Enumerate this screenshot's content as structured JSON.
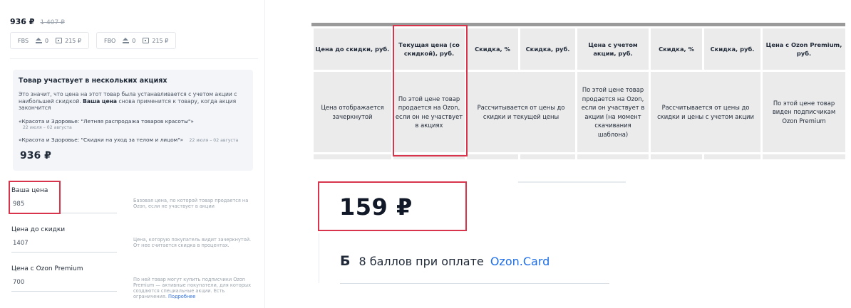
{
  "left": {
    "price": "936 ₽",
    "old_price": "1 407 ₽",
    "stock": [
      {
        "label": "FBS",
        "qty": "0",
        "price": "215 ₽"
      },
      {
        "label": "FBO",
        "qty": "0",
        "price": "215 ₽"
      }
    ],
    "promo": {
      "title": "Товар участвует в нескольких акциях",
      "text_a": "Это значит, что цена на этот товар была устанавливается с учетом акции с наибольшей скидкой.",
      "text_bold": "Ваша цена",
      "text_b": "снова применится к товару, когда акция закончится",
      "items": [
        {
          "name": "«Красота и Здоровье: \"Летняя распродажа товаров красоты\"»",
          "date": "22 июля – 02 августа"
        },
        {
          "name": "«Красота и Здоровье: \"Скидки на уход за телом и лицом\"»",
          "date": "22 июля – 02 августа"
        }
      ],
      "price": "936 ₽"
    },
    "fields": [
      {
        "label": "Ваша цена",
        "value": "985",
        "hint": "Базовая цена, по которой товар продается на Ozon, если не участвует в акции"
      },
      {
        "label": "Цена до скидки",
        "value": "1407",
        "hint": "Цена, которую покупатель видит зачеркнутой. От нее считается скидка в процентах."
      },
      {
        "label": "Цена с Ozon Premium",
        "value": "700",
        "hint": "По ней товар могут купить подписчики Ozon Premium — активные покупатели, для которых создаются специальные акции. Есть ограничения.",
        "hint_link": "Подробнее"
      }
    ]
  },
  "table": {
    "headers": [
      "Цена до скидки, руб.",
      "Текущая цена (со скидкой), руб.",
      "Скидка, %",
      "Скидка, руб.",
      "Цена с учетом акции, руб.",
      "Скидка, %",
      "Скидка, руб.",
      "Цена с Ozon Premium, руб."
    ],
    "body": {
      "col1": "Цена отображается зачеркнутой",
      "col2": "По этой цене товар продается на Ozon, если он не участвует в акциях",
      "col34": "Рассчитывается от цены до скидки и текущей цены",
      "col5": "По этой цене товар продается на Ozon, если он участвует в акции (на момент скачивания шаблона)",
      "col67": "Рассчитывается от цены до скидки и цены с учетом акции",
      "col8": "По этой цене товар виден подписчикам Ozon Premium"
    }
  },
  "card": {
    "price": "159 ₽",
    "points_icon": "Б",
    "points_text": "8 баллов при оплате",
    "points_link": "Ozon.Card"
  },
  "colors": {
    "highlight": "#d8344c",
    "link": "#1d6ee8"
  }
}
